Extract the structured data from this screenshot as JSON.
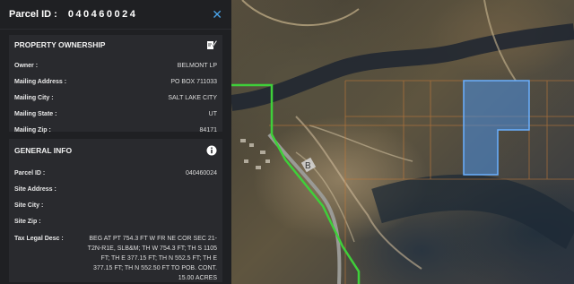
{
  "header": {
    "parcel_label": "Parcel ID :",
    "parcel_value": "040460024",
    "close_icon": "close-icon"
  },
  "ownership": {
    "title": "PROPERTY OWNERSHIP",
    "icon": "edit-document-icon",
    "rows": [
      {
        "label": "Owner :",
        "value": "BELMONT LP"
      },
      {
        "label": "Mailing Address :",
        "value": "PO BOX 711033"
      },
      {
        "label": "Mailing City :",
        "value": "SALT LAKE CITY"
      },
      {
        "label": "Mailing State :",
        "value": "UT"
      },
      {
        "label": "Mailing Zip :",
        "value": "84171"
      }
    ]
  },
  "general": {
    "title": "GENERAL INFO",
    "icon": "info-icon",
    "rows": [
      {
        "label": "Parcel ID :",
        "value": "040460024"
      },
      {
        "label": "Site Address :",
        "value": ""
      },
      {
        "label": "Site City :",
        "value": ""
      },
      {
        "label": "Site Zip :",
        "value": ""
      },
      {
        "label": "Tax Legal Desc :",
        "value": "BEG AT PT 754.3 FT W FR NE COR SEC 21-T2N-R1E, SLB&M; TH W 754.3 FT; TH S 1105 FT; TH E 377.15 FT; TH N 552.5 FT; TH E 377.15 FT; TH N 552.50 FT TO POB. CONT. 15.00 ACRES"
      }
    ]
  },
  "map": {
    "road_label": "B",
    "highlight_color": "#4a90e2",
    "boundary_color": "#3fcf3a"
  }
}
